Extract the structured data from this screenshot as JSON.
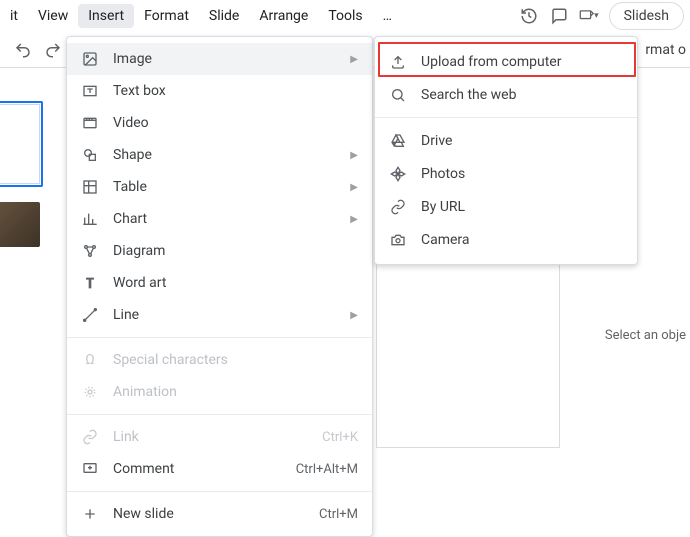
{
  "menubar": {
    "items": [
      {
        "label": "it"
      },
      {
        "label": "View"
      },
      {
        "label": "Insert"
      },
      {
        "label": "Format"
      },
      {
        "label": "Slide"
      },
      {
        "label": "Arrange"
      },
      {
        "label": "Tools"
      },
      {
        "label": "…"
      }
    ],
    "slideshow": "Slidesh"
  },
  "toolbar_right": "rmat o",
  "canvas_right": "Select an obje",
  "insert_menu": {
    "image": "Image",
    "textbox": "Text box",
    "video": "Video",
    "shape": "Shape",
    "table": "Table",
    "chart": "Chart",
    "diagram": "Diagram",
    "wordart": "Word art",
    "line": "Line",
    "special": "Special characters",
    "animation": "Animation",
    "link": {
      "label": "Link",
      "shortcut": "Ctrl+K"
    },
    "comment": {
      "label": "Comment",
      "shortcut": "Ctrl+Alt+M"
    },
    "newslide": {
      "label": "New slide",
      "shortcut": "Ctrl+M"
    }
  },
  "image_submenu": {
    "upload": "Upload from computer",
    "searchweb": "Search the web",
    "drive": "Drive",
    "photos": "Photos",
    "byurl": "By URL",
    "camera": "Camera"
  }
}
